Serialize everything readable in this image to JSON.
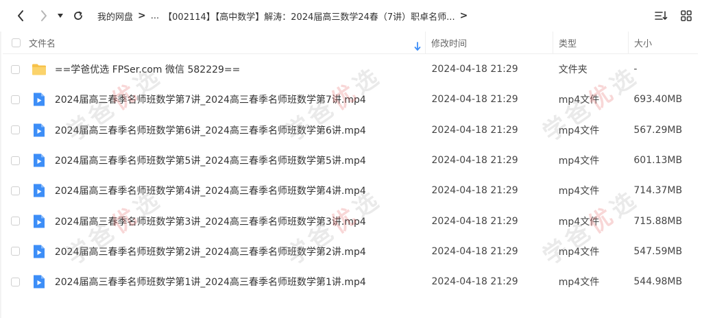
{
  "toolbar": {
    "breadcrumb": {
      "root": "我的网盘",
      "sep": ">",
      "ellipsis": "...",
      "current": "【002114】【高中数学】解涛：2024届高三数学24春（7讲）职卓名师..."
    }
  },
  "table": {
    "headers": {
      "name": "文件名",
      "time": "修改时间",
      "type": "类型",
      "size": "大小"
    },
    "rows": [
      {
        "name": "==学爸优选 FPSer.com 微信 582229==",
        "time": "2024-04-18 21:29",
        "type": "文件夹",
        "size": "-",
        "icon": "folder-icon"
      },
      {
        "name": "2024届高三春季名师班数学第7讲_2024高三春季名师班数学第7讲.mp4",
        "time": "2024-04-18 21:29",
        "type": "mp4文件",
        "size": "693.40MB",
        "icon": "video-file-icon"
      },
      {
        "name": "2024届高三春季名师班数学第6讲_2024高三春季名师班数学第6讲.mp4",
        "time": "2024-04-18 21:29",
        "type": "mp4文件",
        "size": "567.29MB",
        "icon": "video-file-icon"
      },
      {
        "name": "2024届高三春季名师班数学第5讲_2024高三春季名师班数学第5讲.mp4",
        "time": "2024-04-18 21:29",
        "type": "mp4文件",
        "size": "601.13MB",
        "icon": "video-file-icon"
      },
      {
        "name": "2024届高三春季名师班数学第4讲_2024高三春季名师班数学第4讲.mp4",
        "time": "2024-04-18 21:29",
        "type": "mp4文件",
        "size": "714.37MB",
        "icon": "video-file-icon"
      },
      {
        "name": "2024届高三春季名师班数学第3讲_2024高三春季名师班数学第3讲.mp4",
        "time": "2024-04-18 21:29",
        "type": "mp4文件",
        "size": "715.88MB",
        "icon": "video-file-icon"
      },
      {
        "name": "2024届高三春季名师班数学第2讲_2024高三春季名师班数学第2讲.mp4",
        "time": "2024-04-18 21:29",
        "type": "mp4文件",
        "size": "547.59MB",
        "icon": "video-file-icon"
      },
      {
        "name": "2024届高三春季名师班数学第1讲_2024高三春季名师班数学第1讲.mp4",
        "time": "2024-04-18 21:29",
        "type": "mp4文件",
        "size": "544.98MB",
        "icon": "video-file-icon"
      }
    ]
  },
  "watermark": {
    "text_a": "学爸",
    "text_b": "优",
    "text_c": "选"
  },
  "colors": {
    "folder": "#f7c24a",
    "video": "#3d8ef7",
    "sort_arrow": "#3d8ef7"
  }
}
